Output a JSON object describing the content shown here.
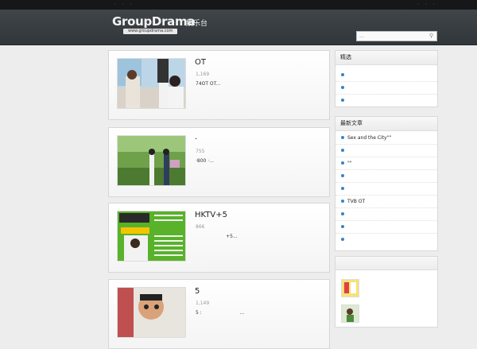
{
  "topbar": {
    "left_dots": "· · ·",
    "right_dots": "· · ·"
  },
  "header": {
    "logo_text": "GroupDrama",
    "logo_cn": "娛乐台",
    "logo_url": "www.groupdrama.com"
  },
  "search": {
    "placeholder": "..."
  },
  "posts": [
    {
      "title": "OT",
      "views": "1,169",
      "excerpt": "74OT OT..."
    },
    {
      "title": "·",
      "views": "755",
      "excerpt": "·800 ·..."
    },
    {
      "title": "HKTV+5",
      "views": "866",
      "excerpt": "                    +5..."
    },
    {
      "title": "5",
      "views": "1,149",
      "excerpt": "5 :                         ..."
    }
  ],
  "widgets": {
    "w1": {
      "title": "精选",
      "items": [
        "",
        "",
        ""
      ]
    },
    "w2": {
      "title": "最新文章",
      "items": [
        "Sex and the City\"\"",
        "",
        "\"\"",
        "",
        "",
        "TVB OT",
        "",
        "",
        ""
      ]
    }
  },
  "colors": {
    "header": "#3a3f43",
    "bullet": "#3a82c4",
    "page_bg": "#ededed"
  }
}
